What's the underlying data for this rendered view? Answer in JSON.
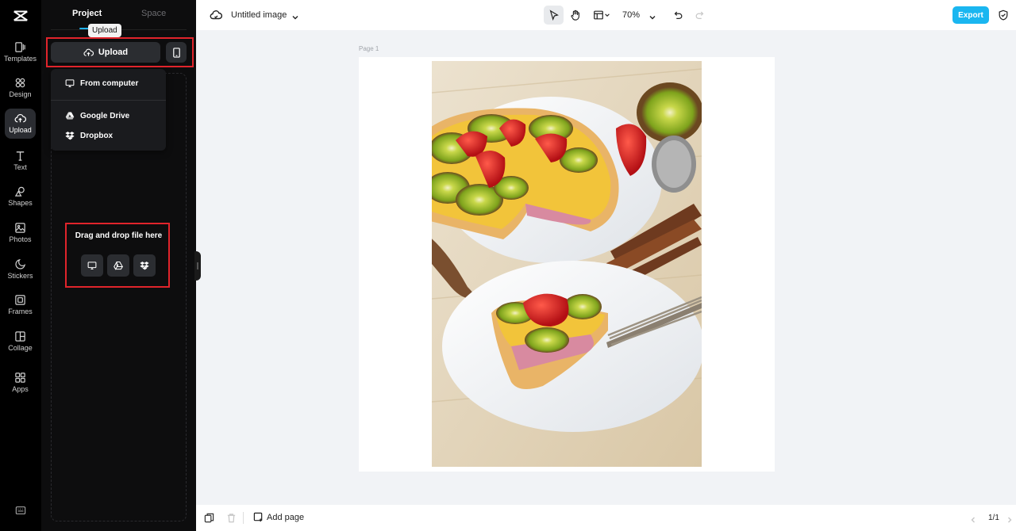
{
  "rail": {
    "items": [
      {
        "label": "Templates"
      },
      {
        "label": "Design"
      },
      {
        "label": "Upload"
      },
      {
        "label": "Text"
      },
      {
        "label": "Shapes"
      },
      {
        "label": "Photos"
      },
      {
        "label": "Stickers"
      },
      {
        "label": "Frames"
      },
      {
        "label": "Collage"
      },
      {
        "label": "Apps"
      }
    ],
    "active": "Upload"
  },
  "panel": {
    "tabs": [
      "Project",
      "Space"
    ],
    "tooltip": "Upload",
    "upload_label": "Upload",
    "dropdown": [
      "From computer",
      "Google Drive",
      "Dropbox"
    ],
    "drop_title": "Drag and drop file here"
  },
  "topbar": {
    "doc_title": "Untitled image",
    "zoom": "70%",
    "export_label": "Export"
  },
  "canvas": {
    "page_label": "Page 1"
  },
  "bottombar": {
    "add_page": "Add page",
    "pager": "1/1"
  },
  "colors": {
    "accent": "#1ab6f0",
    "highlight": "#e0242b",
    "rail_bg": "#000000",
    "panel_bg": "#0d0d0e"
  }
}
